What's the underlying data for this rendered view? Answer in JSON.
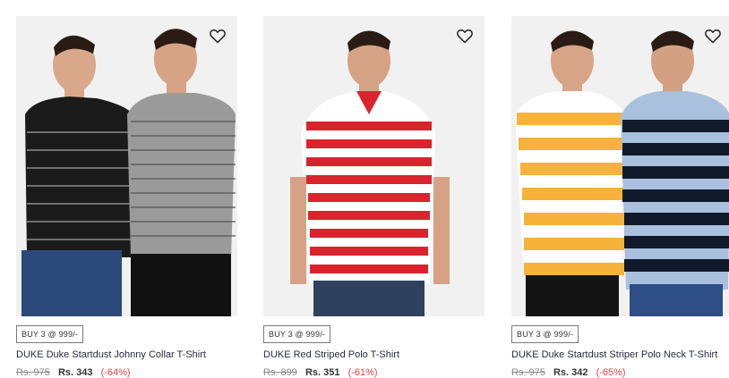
{
  "products": [
    {
      "badge": "BUY 3 @ 999/-",
      "name": "DUKE Duke Startdust Johnny Collar T-Shirt",
      "old_price": "Rs. 975",
      "sale_price": "Rs. 343",
      "discount": "(-64%)"
    },
    {
      "badge": "BUY 3 @ 999/-",
      "name": "DUKE Red Striped Polo T-Shirt",
      "old_price": "Rs. 899",
      "sale_price": "Rs. 351",
      "discount": "(-61%)"
    },
    {
      "badge": "BUY 3 @ 999/-",
      "name": "DUKE Duke Startdust Striper Polo Neck T-Shirt",
      "old_price": "Rs. 975",
      "sale_price": "Rs. 342",
      "discount": "(-65%)"
    }
  ],
  "icons": {
    "wishlist": "heart-outline-icon"
  },
  "colors": {
    "discount": "#e2433e",
    "card_bg": "#f1f1f1"
  }
}
